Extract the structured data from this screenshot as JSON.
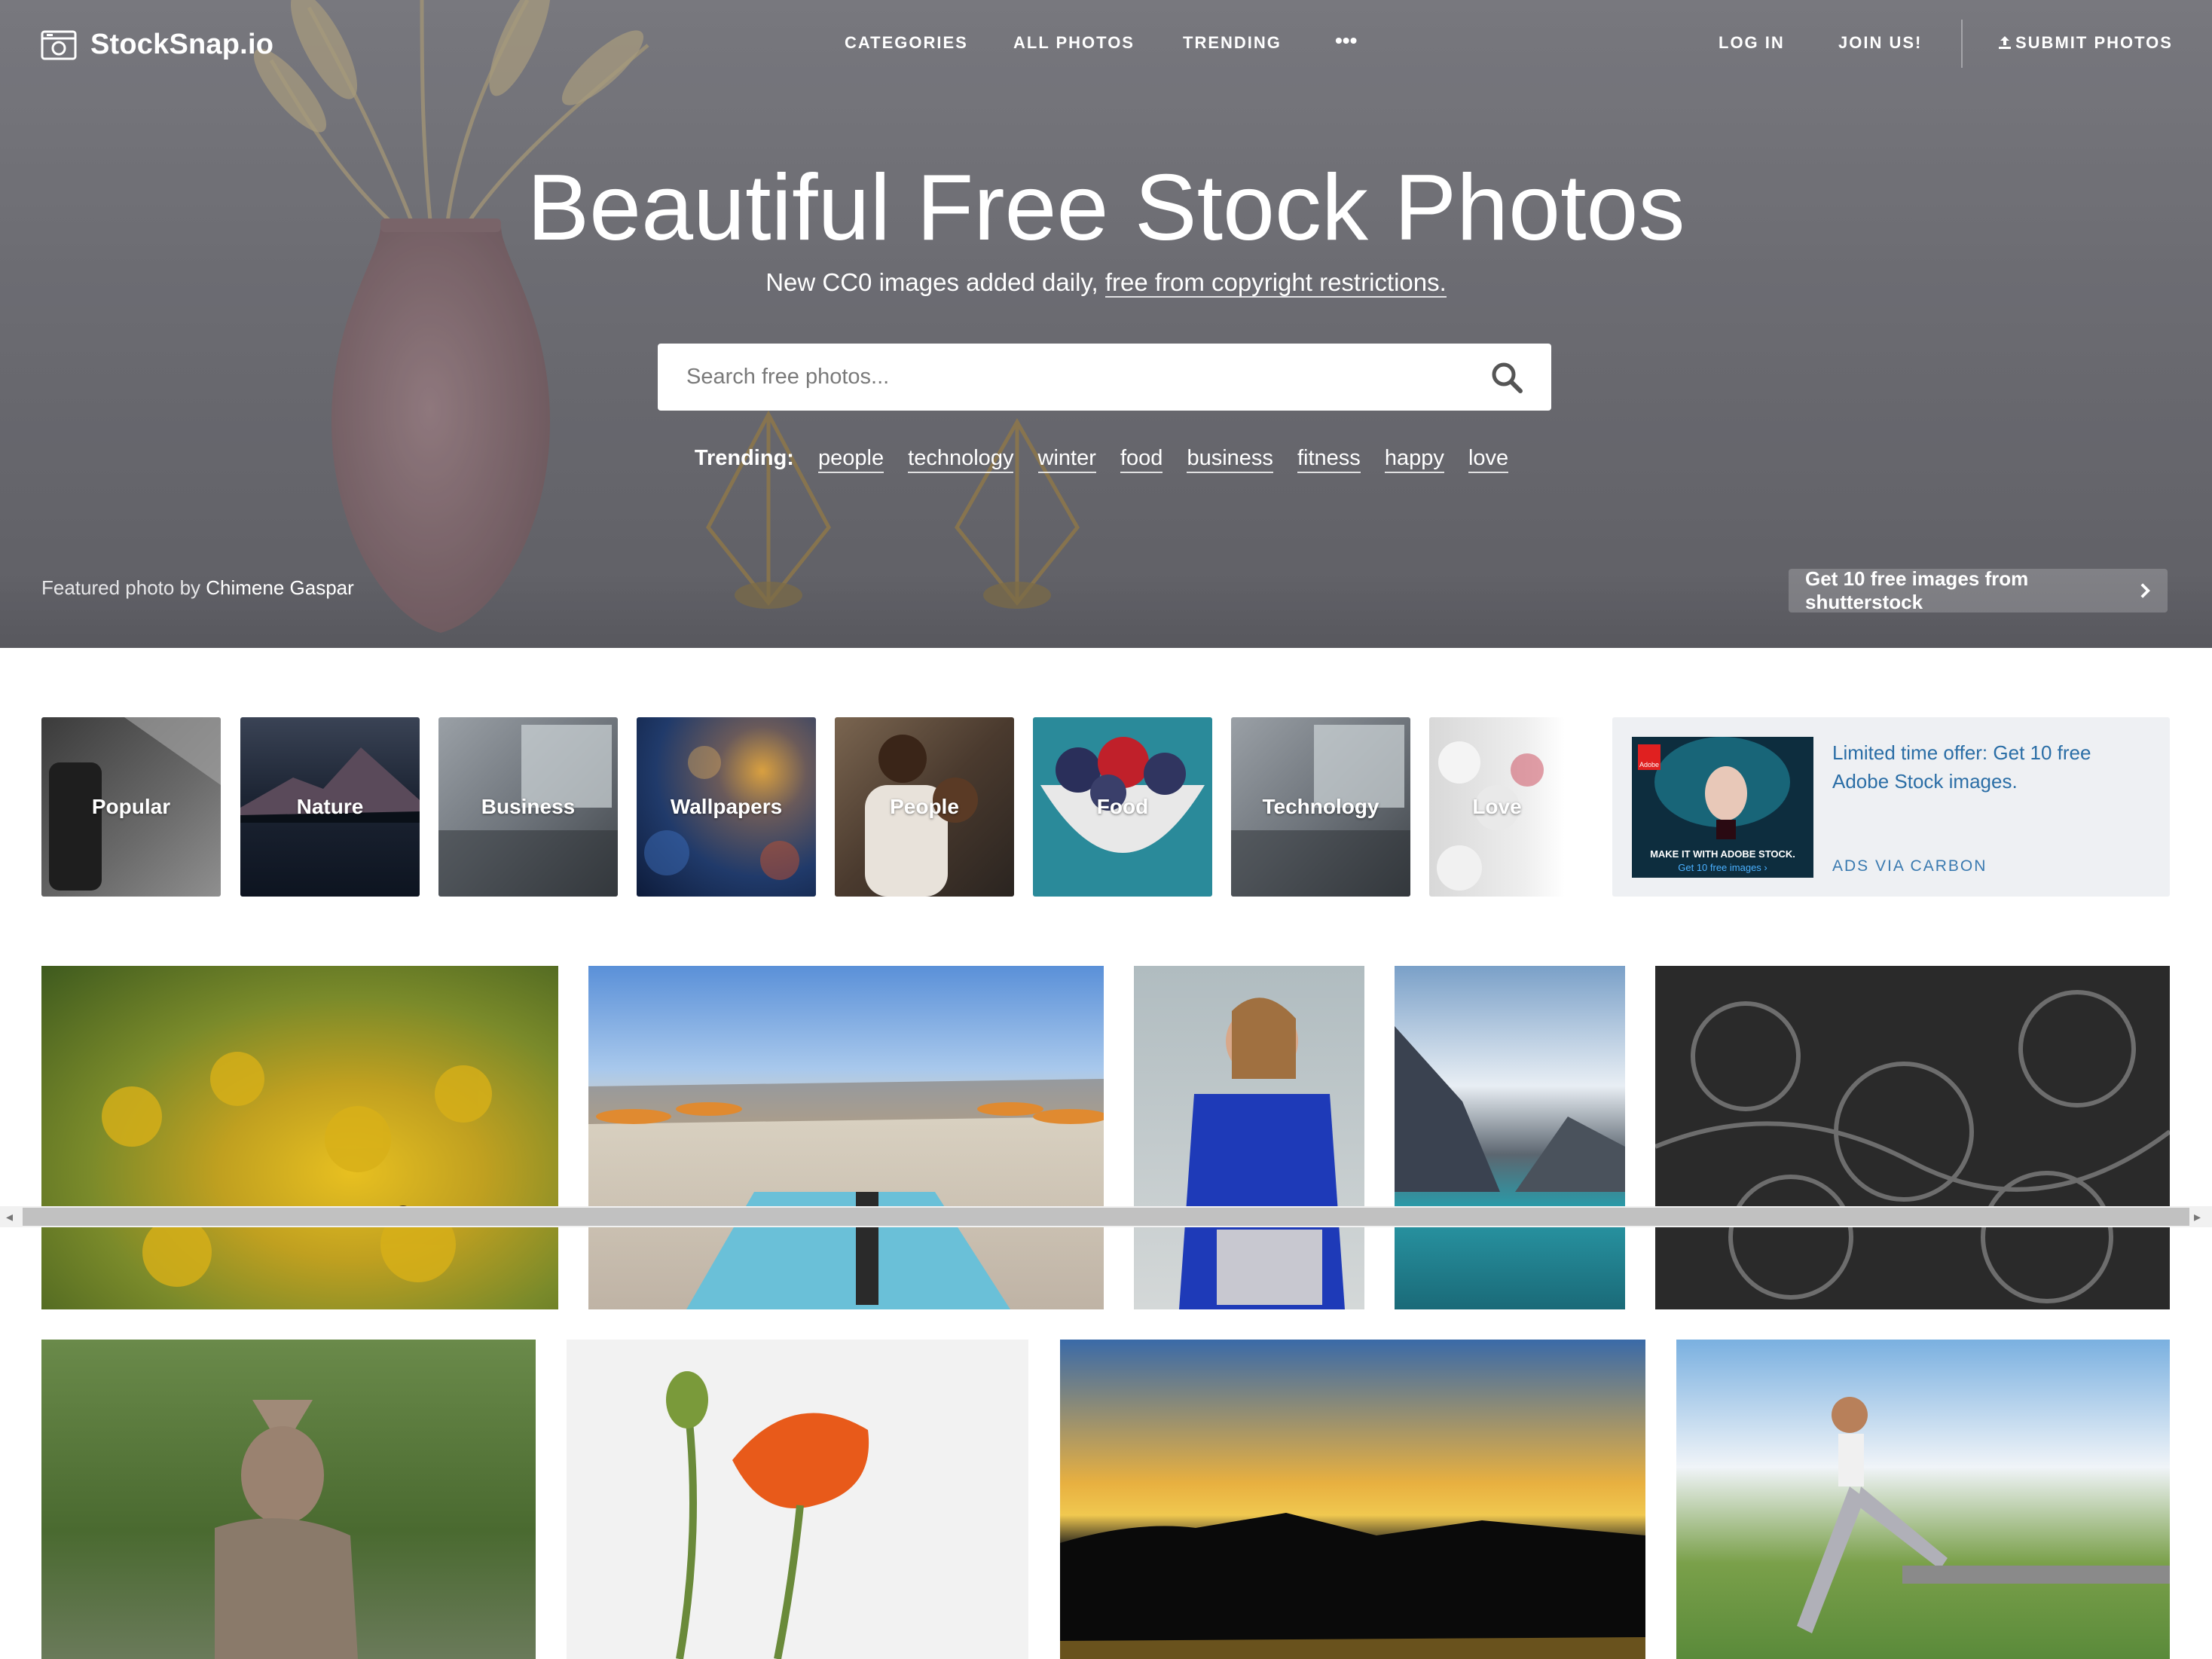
{
  "brand": {
    "name": "StockSnap.io",
    "logo_icon": "camera-icon"
  },
  "nav": {
    "categories": "CATEGORIES",
    "all_photos": "ALL PHOTOS",
    "trending": "TRENDING",
    "more": "•••",
    "login": "LOG IN",
    "join": "JOIN US!",
    "submit": "SUBMIT PHOTOS"
  },
  "hero": {
    "title": "Beautiful Free Stock Photos",
    "subtitle_prefix": "New CC0 images added daily, ",
    "subtitle_link": "free from copyright restrictions.",
    "search_placeholder": "Search free photos...",
    "trending_label": "Trending:",
    "trending_tags": [
      "people",
      "technology",
      "winter",
      "food",
      "business",
      "fitness",
      "happy",
      "love"
    ],
    "featured_prefix": "Featured photo by ",
    "featured_author": "Chimene Gaspar",
    "shutterstock_cta": "Get 10 free images from shutterstock"
  },
  "categories": [
    "Popular",
    "Nature",
    "Business",
    "Wallpapers",
    "People",
    "Food",
    "Technology",
    "Love"
  ],
  "ad": {
    "text": "Limited time offer: Get 10 free Adobe Stock images.",
    "via": "ADS VIA CARBON",
    "image_caption_1": "MAKE IT WITH ADOBE STOCK.",
    "image_caption_2": "Get 10 free images ›",
    "brand_mark": "Adobe"
  },
  "colors": {
    "link_blue": "#2b6ea6",
    "ad_bg": "#eef0f3"
  }
}
